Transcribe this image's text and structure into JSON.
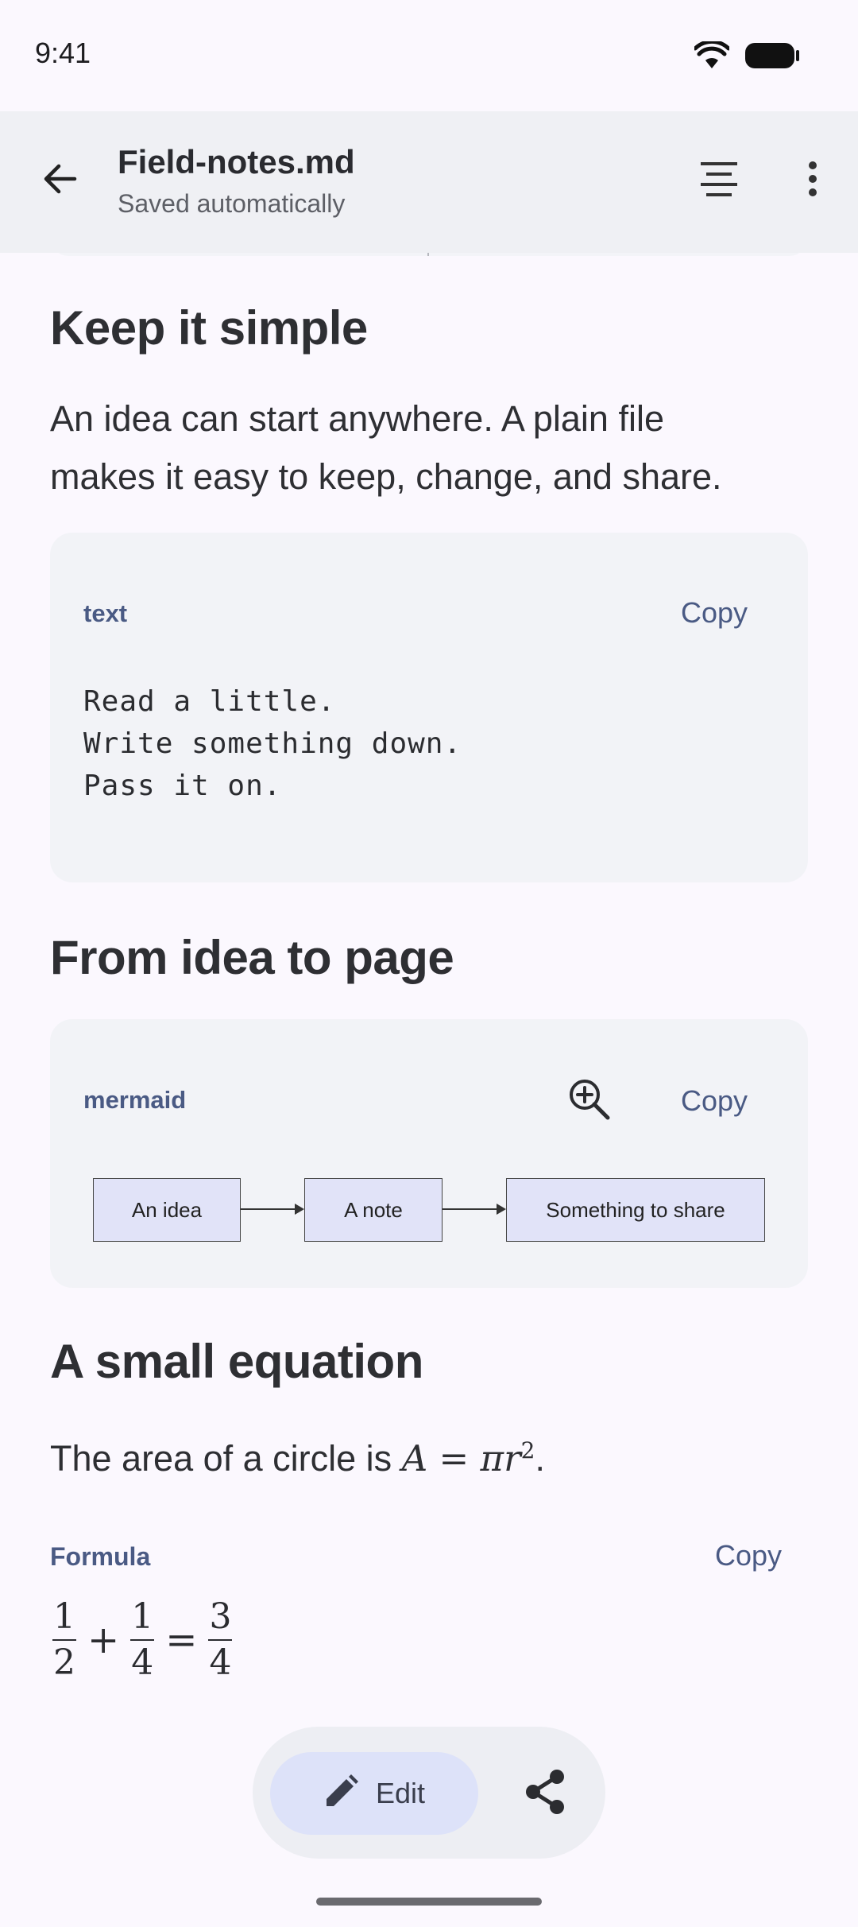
{
  "status_bar": {
    "time": "9:41"
  },
  "app_bar": {
    "title": "Field-notes.md",
    "subtitle": "Saved automatically",
    "icons": [
      "back-arrow-icon",
      "table-of-contents-icon",
      "more-vert-icon"
    ]
  },
  "sections": {
    "s1": {
      "heading": "Keep it simple",
      "paragraph_line1": "An idea can start anywhere. A plain file",
      "paragraph_line2": "makes it easy to keep, change, and share."
    },
    "code_block": {
      "language": "text",
      "copy_label": "Copy",
      "lines": [
        "Read a little.",
        "Write something down.",
        "Pass it on."
      ]
    },
    "s2": {
      "heading": "From idea to page"
    },
    "diagram_block": {
      "language": "mermaid",
      "copy_label": "Copy",
      "nodes": [
        "An idea",
        "A note",
        "Something to share"
      ]
    },
    "s3": {
      "heading": "A small equation",
      "paragraph_prefix": "The area of a circle is ",
      "math_A": "A",
      "math_eq": " = ",
      "math_pi_r": "πr",
      "math_exp": "2",
      "paragraph_suffix": "."
    },
    "formula_block": {
      "label": "Formula",
      "copy_label": "Copy",
      "frac1_num": "1",
      "frac1_den": "2",
      "plus": "+",
      "frac2_num": "1",
      "frac2_den": "4",
      "equals": "=",
      "frac3_num": "3",
      "frac3_den": "4"
    }
  },
  "bottom_bar": {
    "edit_label": "Edit"
  },
  "colors": {
    "background": "#fbf8fe",
    "app_bar": "#eff0f4",
    "card": "#f2f3f7",
    "accent": "#4a5a84",
    "diagram_node": "#e1e3f8",
    "edit_button": "#dde2f9"
  }
}
